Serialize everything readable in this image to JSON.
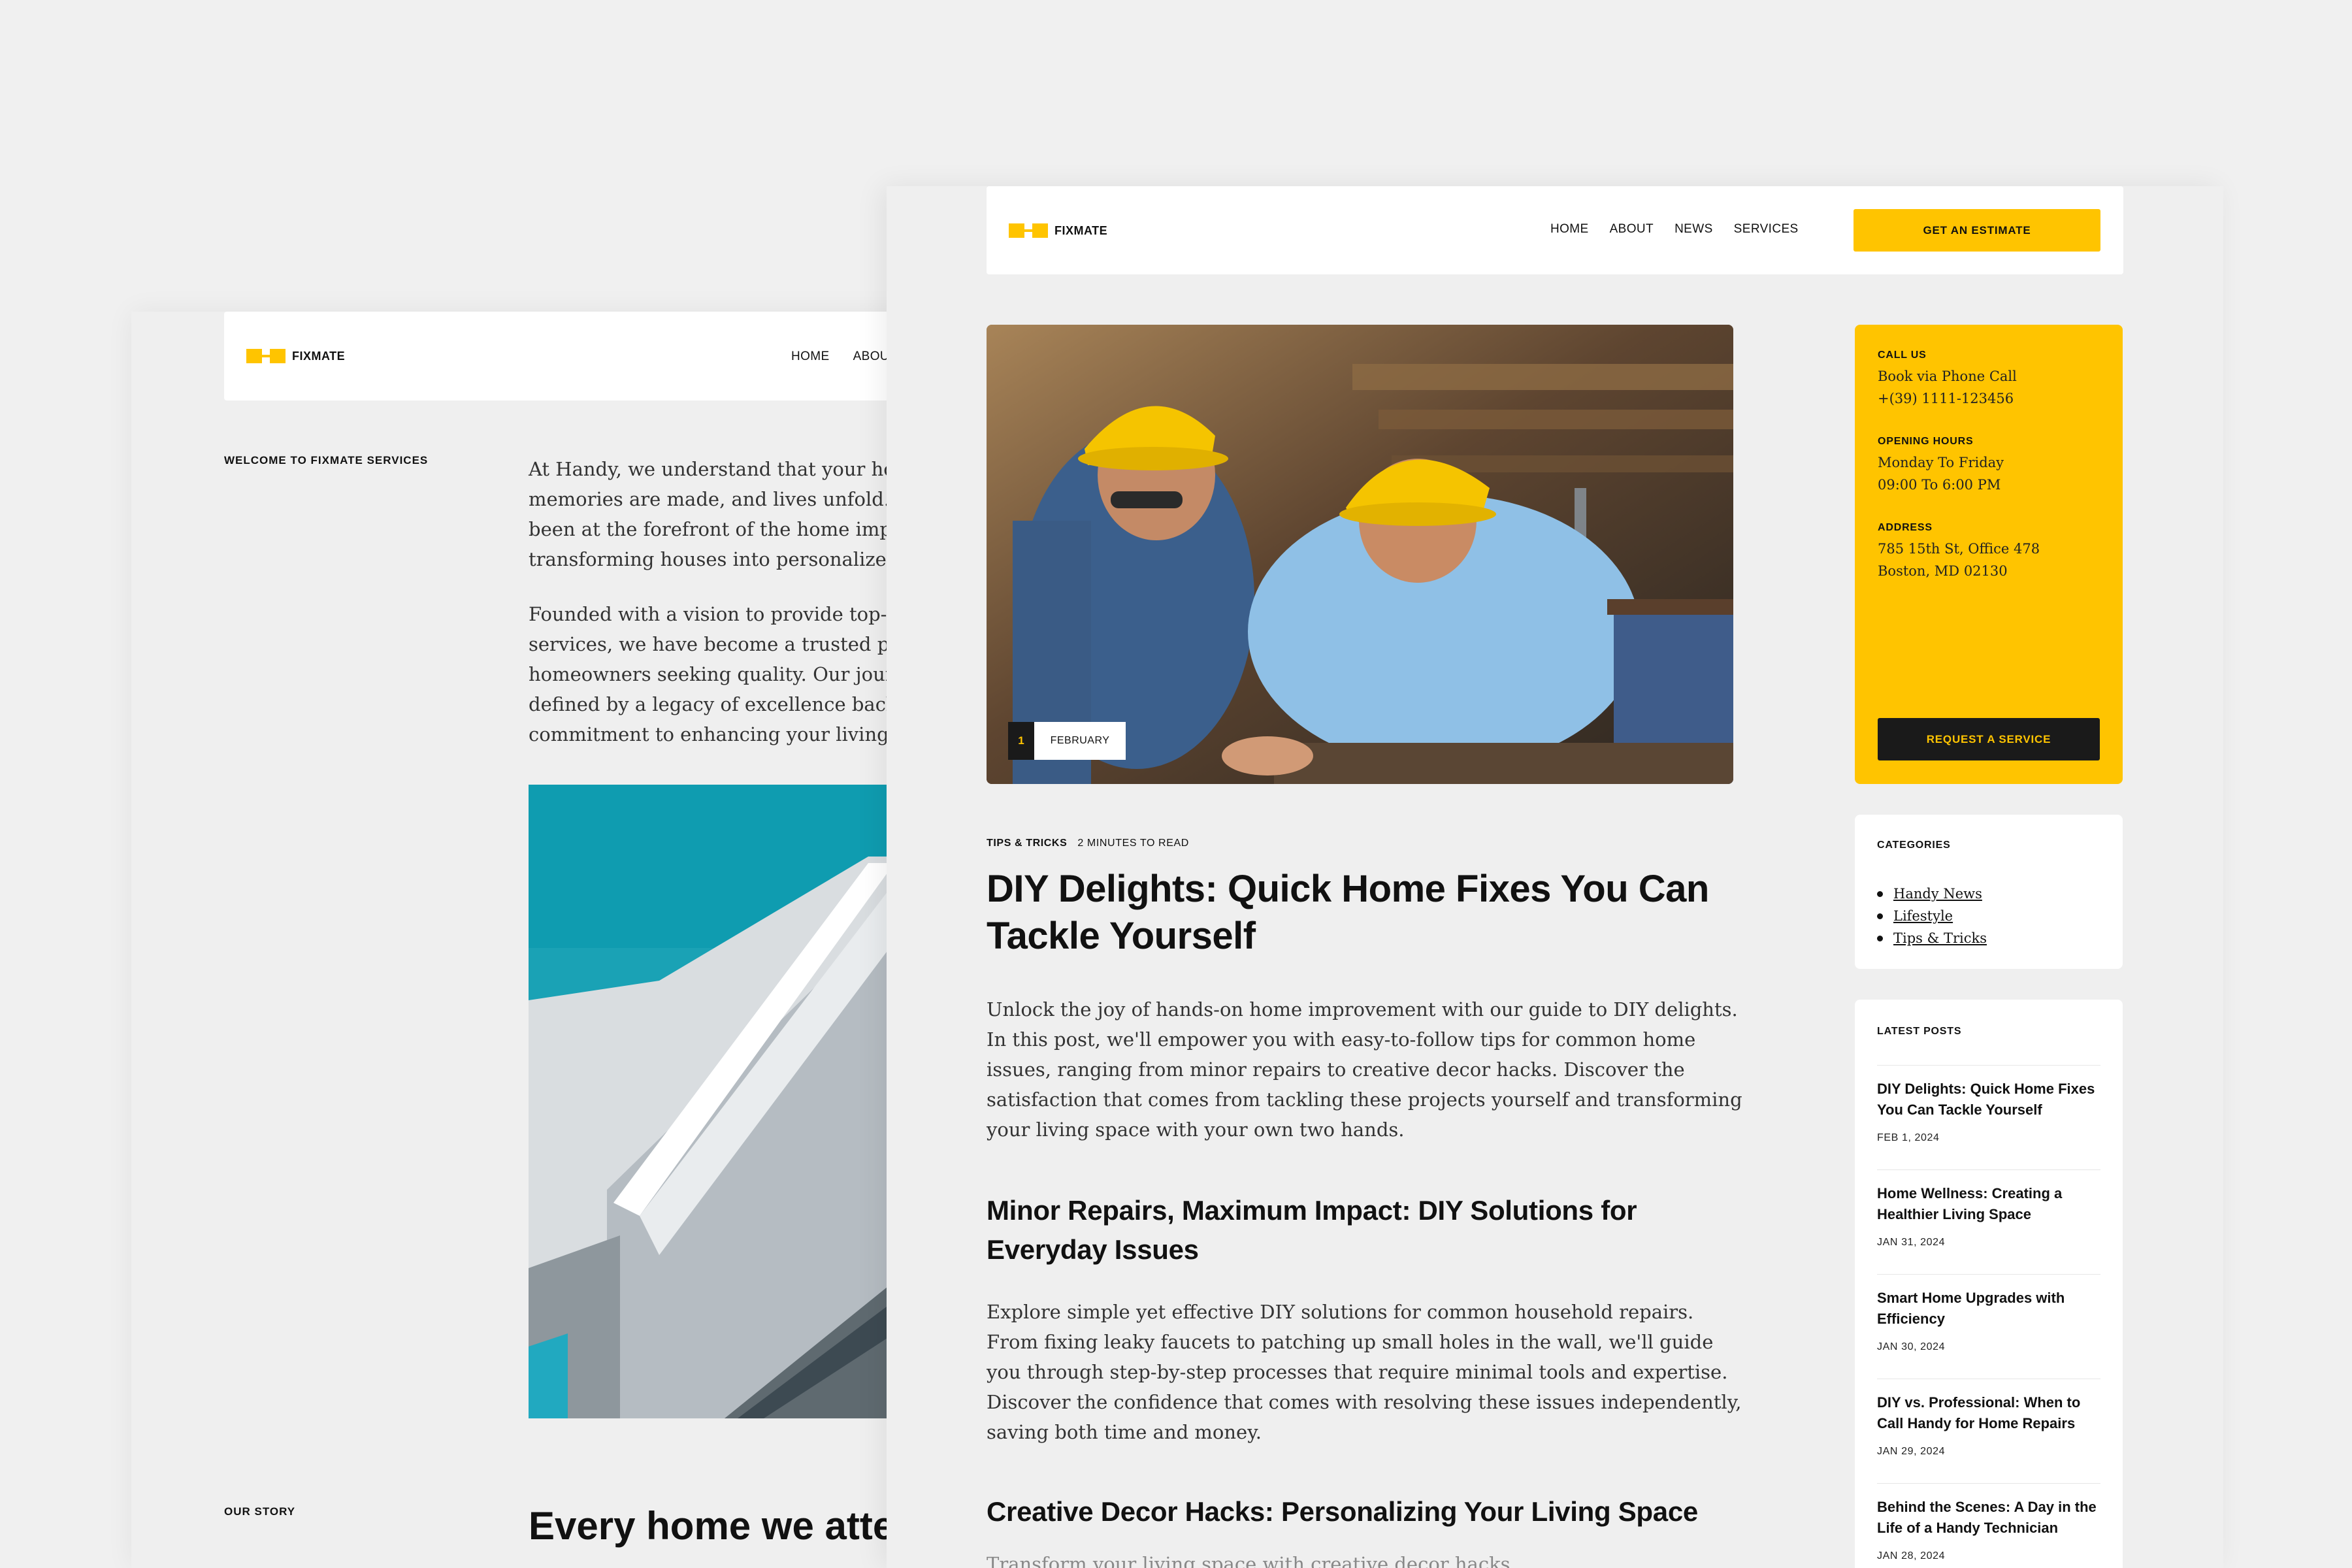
{
  "brand": {
    "name": "FIXMATE",
    "accent": "#ffc400",
    "dark": "#1a1a1a"
  },
  "back_page": {
    "nav": [
      "HOME",
      "ABOUT"
    ],
    "welcome_label": "WELCOME TO FIXMATE SERVICES",
    "para1": "At Handy, we understand that your home is where memories are made, and lives unfold. We have been at the forefront of the home improvement, transforming houses into personalized homes.",
    "para2": "Founded with a vision to provide top-notch services, we have become a trusted partner for homeowners seeking quality. Our journey is defined by a legacy of excellence backed by a commitment to enhancing your living experience.",
    "story_label": "OUR STORY",
    "headline": "Every home we attend to is a transformation"
  },
  "front_page": {
    "nav": [
      "HOME",
      "ABOUT",
      "NEWS",
      "SERVICES"
    ],
    "estimate_button": "GET AN ESTIMATE",
    "hero": {
      "day": "1",
      "month": "FEBRUARY"
    },
    "meta": {
      "category": "TIPS & TRICKS",
      "read_time": "2 MINUTES TO READ"
    },
    "title": "DIY Delights: Quick Home Fixes You Can Tackle Yourself",
    "intro": "Unlock the joy of hands-on home improvement with our guide to DIY delights. In this post, we'll empower you with easy-to-follow tips for common home issues, ranging from minor repairs to creative decor hacks. Discover the satisfaction that comes from tackling these projects yourself and transforming your living space with your own two hands.",
    "h2_1": "Minor Repairs, Maximum Impact: DIY Solutions for Everyday Issues",
    "body1": "Explore simple yet effective DIY solutions for common household repairs. From fixing leaky faucets to patching up small holes in the wall, we'll guide you through step-by-step processes that require minimal tools and expertise. Discover the confidence that comes with resolving these issues independently, saving both time and money.",
    "h2_2": "Creative Decor Hacks: Personalizing Your Living Space",
    "trail": "Transform your living space with creative decor hacks."
  },
  "contact": {
    "call_label": "CALL US",
    "call_line1": "Book via Phone Call",
    "call_line2": "+(39) 1111-123456",
    "hours_label": "OPENING HOURS",
    "hours_line1": "Monday To Friday",
    "hours_line2": "09:00 To 6:00 PM",
    "address_label": "ADDRESS",
    "address_line1": "785 15th St, Office 478",
    "address_line2": "Boston, MD 02130",
    "request_button": "REQUEST A SERVICE"
  },
  "categories": {
    "label": "CATEGORIES",
    "items": [
      "Handy News",
      "Lifestyle",
      "Tips & Tricks"
    ]
  },
  "latest_posts": {
    "label": "LATEST POSTS",
    "items": [
      {
        "title": "DIY Delights: Quick Home Fixes You Can Tackle Yourself",
        "date": "FEB 1, 2024"
      },
      {
        "title": "Home Wellness: Creating a Healthier Living Space",
        "date": "JAN 31, 2024"
      },
      {
        "title": "Smart Home Upgrades with Efficiency",
        "date": "JAN 30, 2024"
      },
      {
        "title": "DIY vs. Professional: When to Call Handy for Home Repairs",
        "date": "JAN 29, 2024"
      },
      {
        "title": "Behind the Scenes: A Day in the Life of a Handy Technician",
        "date": "JAN 28, 2024"
      }
    ]
  }
}
